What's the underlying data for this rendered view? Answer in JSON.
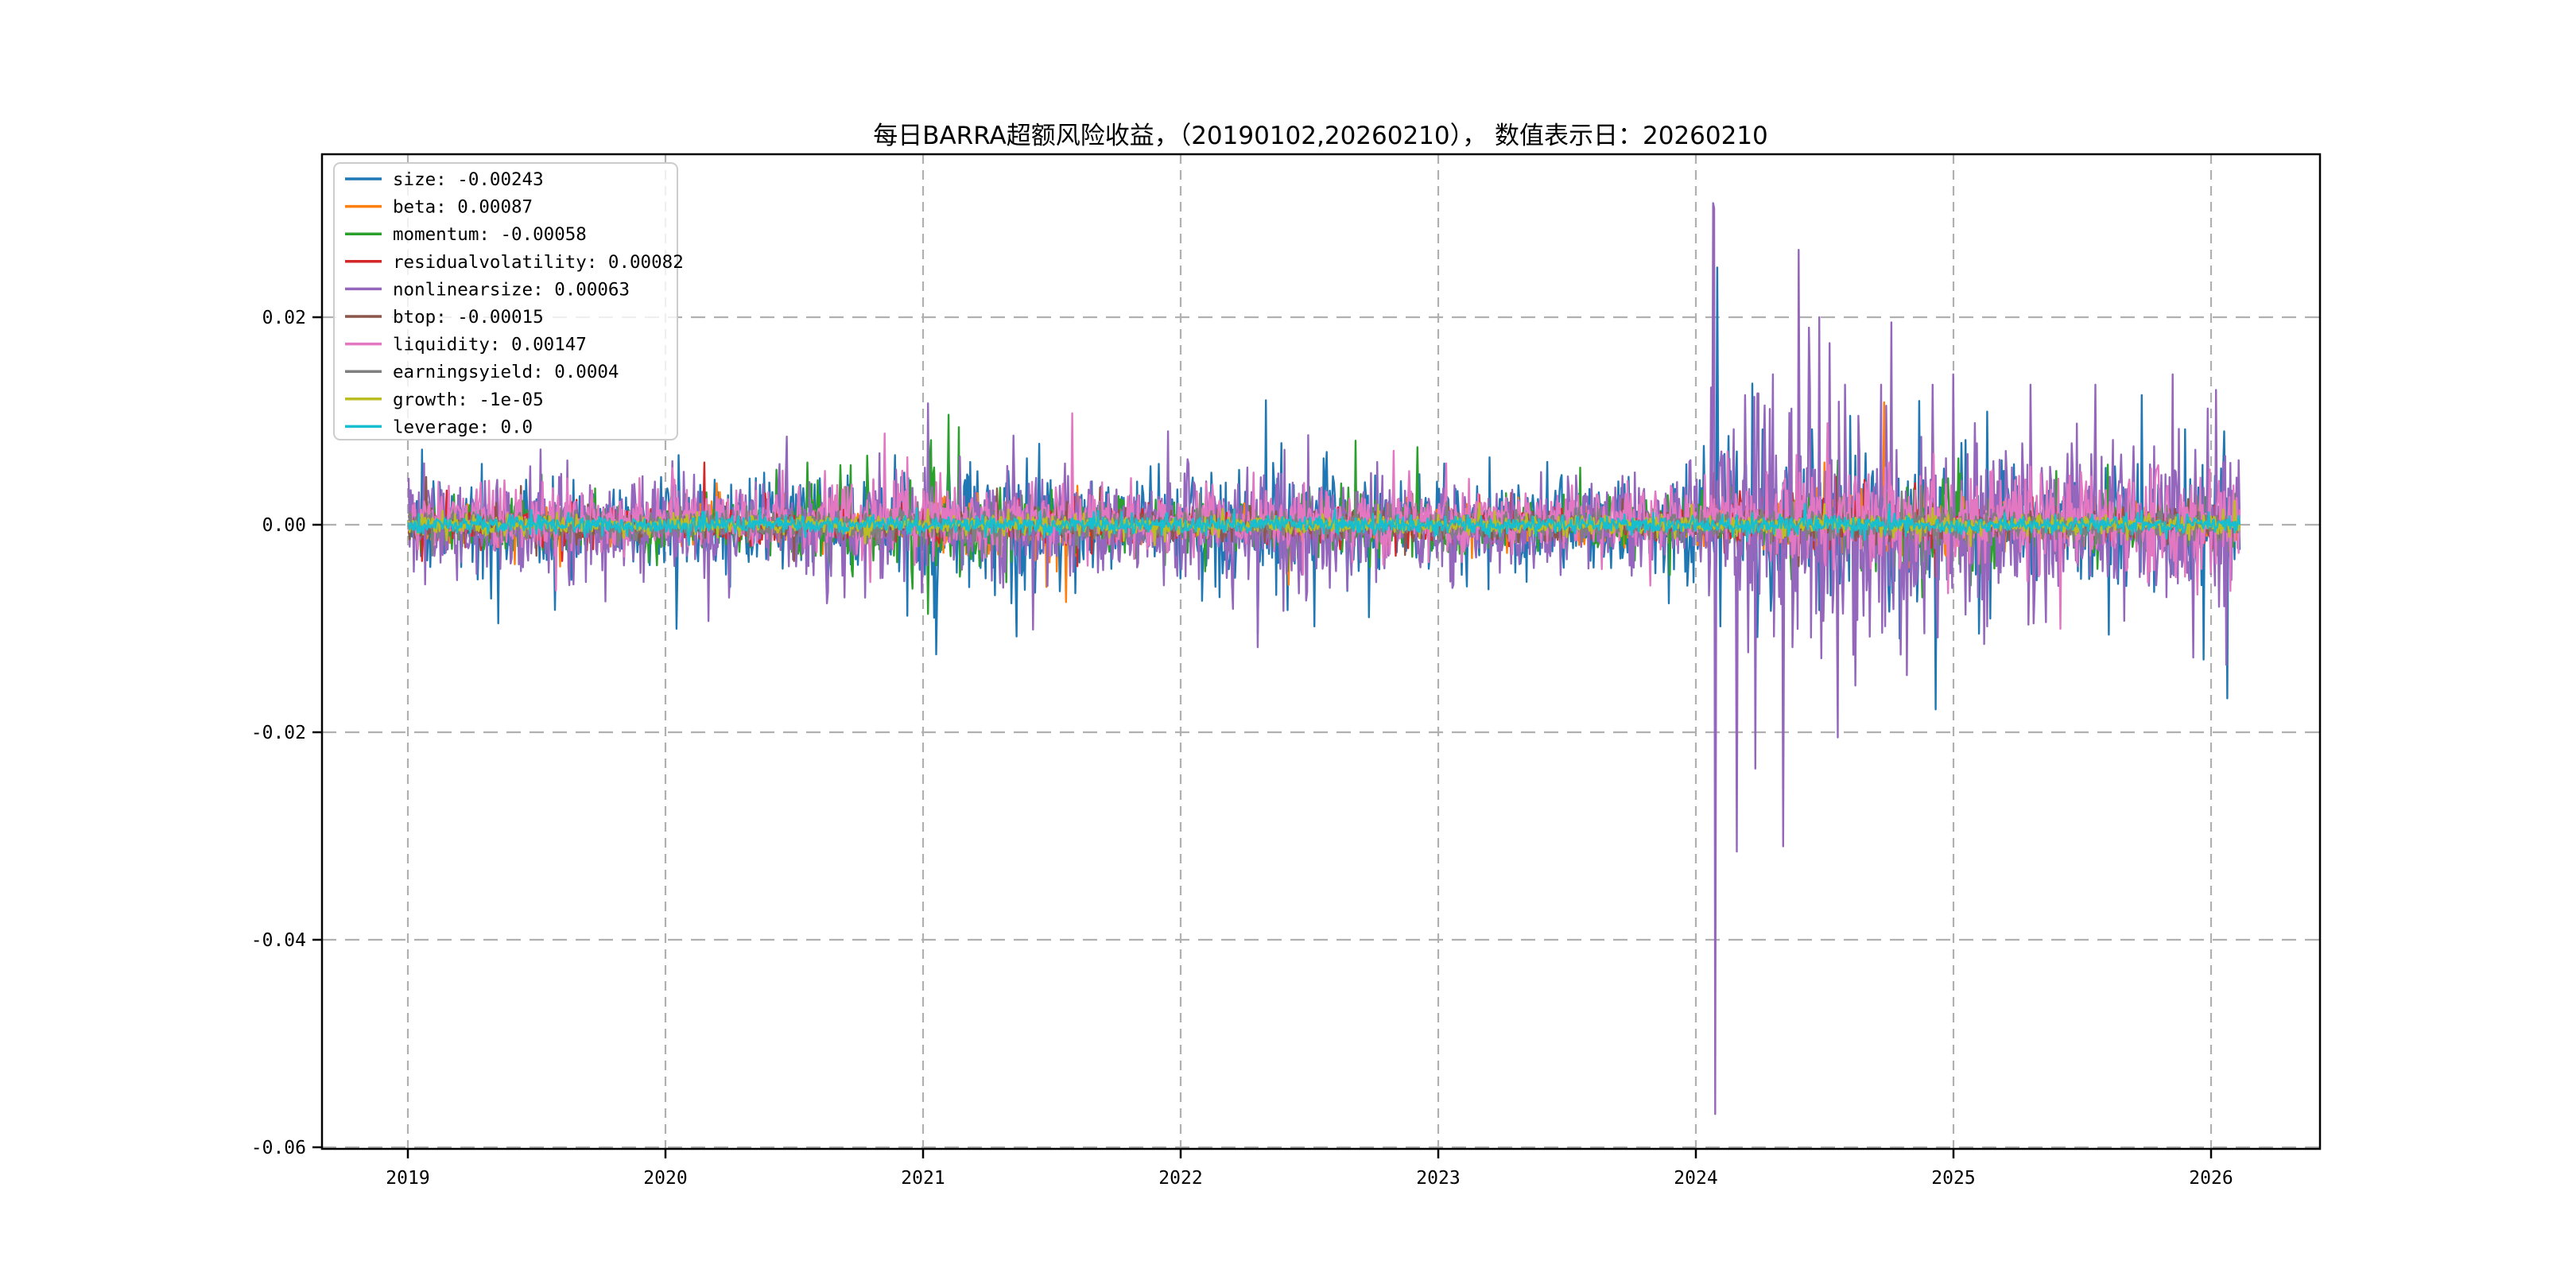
{
  "chart_data": {
    "type": "line",
    "title": "每日BARRA超额风险收益，（20190102,20260210）， 数值表示日：20260210",
    "xlabel": "",
    "ylabel": "",
    "grid": true,
    "legend_position": "upper left",
    "background_color": "#ffffff",
    "grid_color": "#b0b0b0",
    "frame_color": "#000000",
    "ylim": [
      -0.0601,
      0.0357
    ],
    "xlim": [
      2018.667,
      2026.42
    ],
    "x_tick_values": [
      2019,
      2020,
      2021,
      2022,
      2023,
      2024,
      2025,
      2026
    ],
    "x_tick_labels": [
      "2019",
      "2020",
      "2021",
      "2022",
      "2023",
      "2024",
      "2025",
      "2026"
    ],
    "y_tick_values": [
      0.02,
      0.0,
      -0.02,
      -0.04,
      -0.06
    ],
    "y_tick_labels": [
      "0.02",
      "0.00",
      "-0.02",
      "-0.04",
      "-0.06"
    ],
    "x_start": 2019.003,
    "x_end": 2026.112,
    "points_per_year": 250,
    "series": [
      {
        "name": "size",
        "color": "#1f77b4",
        "legend_label": "size: -0.00243",
        "final_value": -0.00243,
        "mean": 0,
        "base_sigma": 0.0021,
        "vol_profile": [
          [
            2019.0,
            2021.0,
            0.0021
          ],
          [
            2021.0,
            2021.6,
            0.0027
          ],
          [
            2021.6,
            2022.0,
            0.0023
          ],
          [
            2022.0,
            2022.75,
            0.003
          ],
          [
            2022.75,
            2023.9,
            0.0021
          ],
          [
            2023.9,
            2025.3,
            0.0032
          ],
          [
            2025.3,
            2026.2,
            0.0029
          ]
        ],
        "spikes": [
          [
            2019.35,
            -0.0095
          ],
          [
            2020.25,
            -0.006
          ],
          [
            2021.05,
            -0.0125
          ],
          [
            2021.45,
            0.0078
          ],
          [
            2022.3,
            -0.0105
          ],
          [
            2022.33,
            0.012
          ],
          [
            2022.52,
            -0.0098
          ],
          [
            2023.2,
            0.0065
          ],
          [
            2024.084,
            0.0248
          ],
          [
            2024.096,
            -0.0098
          ],
          [
            2024.45,
            0.0092
          ],
          [
            2024.6,
            0.0105
          ],
          [
            2024.93,
            -0.0178
          ],
          [
            2025.1,
            -0.0105
          ],
          [
            2025.73,
            0.0125
          ],
          [
            2025.9,
            0.0092
          ],
          [
            2025.97,
            -0.013
          ],
          [
            2026.05,
            0.009
          ]
        ]
      },
      {
        "name": "beta",
        "color": "#ff7f0e",
        "legend_label": "beta: 0.00087",
        "final_value": 0.00087,
        "mean": 0,
        "base_sigma": 0.00085,
        "vol_profile": [
          [
            2021.0,
            2021.6,
            0.0015
          ],
          [
            2024.3,
            2025.05,
            0.0015
          ]
        ],
        "spikes": [
          [
            2020.2,
            0.004
          ],
          [
            2021.35,
            0.0062
          ],
          [
            2021.48,
            -0.006
          ],
          [
            2022.42,
            -0.0058
          ],
          [
            2024.5,
            0.006
          ],
          [
            2024.73,
            0.0118
          ],
          [
            2025.0,
            0.005
          ]
        ]
      },
      {
        "name": "momentum",
        "color": "#2ca02c",
        "legend_label": "momentum: -0.00058",
        "final_value": -0.00058,
        "mean": 0,
        "base_sigma": 0.0012,
        "vol_profile": [
          [
            2020.45,
            2021.35,
            0.0021
          ],
          [
            2022.4,
            2022.8,
            0.0018
          ],
          [
            2024.35,
            2025.15,
            0.0021
          ]
        ],
        "spikes": [
          [
            2020.55,
            0.006
          ],
          [
            2021.02,
            -0.0086
          ],
          [
            2021.1,
            0.0106
          ],
          [
            2021.14,
            0.0094
          ],
          [
            2022.68,
            0.0081
          ],
          [
            2023.55,
            0.0055
          ],
          [
            2024.55,
            0.0062
          ],
          [
            2024.88,
            -0.007
          ],
          [
            2025.02,
            0.0064
          ],
          [
            2025.6,
            0.0058
          ]
        ]
      },
      {
        "name": "residualvolatility",
        "color": "#d62728",
        "legend_label": "residualvolatility: 0.00082",
        "final_value": 0.00082,
        "mean": 0,
        "base_sigma": 0.00085,
        "vol_profile": [
          [
            2024.05,
            2024.95,
            0.0013
          ]
        ],
        "spikes": [
          [
            2019.6,
            -0.0035
          ],
          [
            2020.15,
            0.006
          ],
          [
            2021.6,
            -0.004
          ],
          [
            2024.07,
            0.005
          ],
          [
            2024.45,
            0.0045
          ],
          [
            2024.85,
            0.004
          ]
        ]
      },
      {
        "name": "nonlinearsize",
        "color": "#9467bd",
        "legend_label": "nonlinearsize: 0.00063",
        "final_value": 0.00063,
        "mean": 0,
        "base_sigma": 0.0021,
        "vol_profile": [
          [
            2020.6,
            2021.6,
            0.0027
          ],
          [
            2022.0,
            2022.75,
            0.0027
          ],
          [
            2022.75,
            2023.9,
            0.0021
          ],
          [
            2023.9,
            2024.05,
            0.0027
          ],
          [
            2024.05,
            2024.8,
            0.0052
          ],
          [
            2024.8,
            2025.6,
            0.004
          ],
          [
            2025.6,
            2026.2,
            0.0036
          ]
        ],
        "spikes": [
          [
            2019.62,
            0.0062
          ],
          [
            2020.47,
            0.0085
          ],
          [
            2021.02,
            0.0117
          ],
          [
            2021.35,
            0.0086
          ],
          [
            2021.95,
            0.009
          ],
          [
            2022.3,
            -0.0118
          ],
          [
            2024.068,
            0.031
          ],
          [
            2024.072,
            0.0305
          ],
          [
            2024.076,
            -0.0568
          ],
          [
            2024.09,
            0.006
          ],
          [
            2024.16,
            -0.0315
          ],
          [
            2024.19,
            0.0125
          ],
          [
            2024.23,
            -0.0235
          ],
          [
            2024.3,
            0.0145
          ],
          [
            2024.34,
            -0.031
          ],
          [
            2024.4,
            0.0265
          ],
          [
            2024.44,
            0.019
          ],
          [
            2024.48,
            0.02
          ],
          [
            2024.52,
            0.0175
          ],
          [
            2024.55,
            -0.0205
          ],
          [
            2024.58,
            0.0135
          ],
          [
            2024.62,
            -0.0155
          ],
          [
            2024.72,
            0.0135
          ],
          [
            2024.76,
            0.0195
          ],
          [
            2024.82,
            -0.0145
          ],
          [
            2024.92,
            0.0135
          ],
          [
            2025.0,
            0.0145
          ],
          [
            2025.12,
            -0.0115
          ],
          [
            2025.3,
            0.0135
          ],
          [
            2025.55,
            0.0135
          ],
          [
            2025.85,
            0.0145
          ],
          [
            2025.93,
            -0.0128
          ],
          [
            2026.02,
            0.013
          ],
          [
            2026.06,
            -0.0135
          ]
        ]
      },
      {
        "name": "btop",
        "color": "#8c564b",
        "legend_label": "btop: -0.00015",
        "final_value": -0.00015,
        "mean": 0,
        "base_sigma": 0.00065,
        "vol_profile": [],
        "spikes": [
          [
            2019.07,
            0.0046
          ],
          [
            2019.5,
            -0.003
          ],
          [
            2020.5,
            -0.0035
          ],
          [
            2022.9,
            0.003
          ],
          [
            2024.4,
            -0.004
          ]
        ]
      },
      {
        "name": "liquidity",
        "color": "#e377c2",
        "legend_label": "liquidity: 0.00147",
        "final_value": 0.00147,
        "mean": 0.0005,
        "base_sigma": 0.0014,
        "vol_profile": [
          [
            2020.6,
            2021.1,
            0.0019
          ],
          [
            2024.3,
            2026.2,
            0.0024
          ]
        ],
        "spikes": [
          [
            2019.9,
            0.0045
          ],
          [
            2020.85,
            0.0088
          ],
          [
            2020.92,
            0.0052
          ],
          [
            2022.1,
            0.004
          ],
          [
            2024.75,
            0.006
          ],
          [
            2025.3,
            0.0056
          ],
          [
            2025.9,
            -0.005
          ]
        ]
      },
      {
        "name": "earningsyield",
        "color": "#7f7f7f",
        "legend_label": "earningsyield: 0.0004",
        "final_value": 0.0004,
        "mean": 0,
        "base_sigma": 0.00065,
        "vol_profile": [],
        "spikes": [
          [
            2021.3,
            -0.003
          ],
          [
            2024.8,
            0.0032
          ]
        ]
      },
      {
        "name": "growth",
        "color": "#bcbd22",
        "legend_label": "growth: -1e-05",
        "final_value": -1e-05,
        "mean": 0,
        "base_sigma": 0.00042,
        "vol_profile": [],
        "spikes": [
          [
            2021.9,
            -0.002
          ],
          [
            2024.5,
            0.002
          ]
        ]
      },
      {
        "name": "leverage",
        "color": "#17becf",
        "legend_label": "leverage: 0.0",
        "final_value": 0.0,
        "mean": 0,
        "base_sigma": 0.00042,
        "vol_profile": [],
        "spikes": [
          [
            2022.6,
            0.0015
          ],
          [
            2024.2,
            -0.0016
          ],
          [
            2024.75,
            0.002
          ]
        ]
      }
    ]
  }
}
